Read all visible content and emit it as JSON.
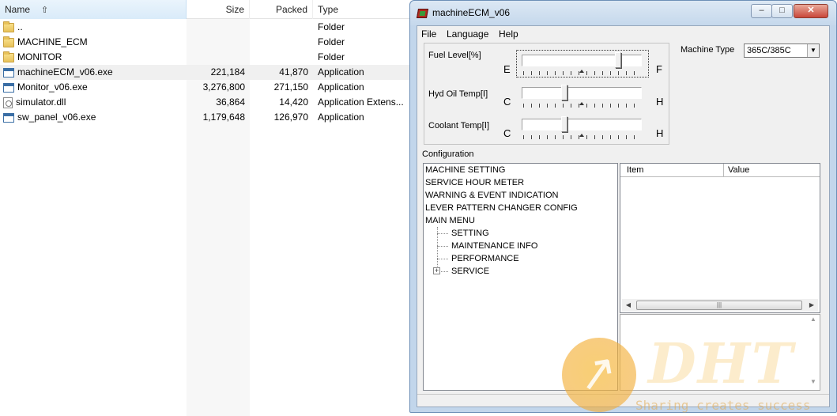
{
  "file_manager": {
    "columns": {
      "name": "Name",
      "size": "Size",
      "packed": "Packed",
      "type": "Type"
    },
    "sort_icon": "sort-up-arrow-icon",
    "rows": [
      {
        "name": "..",
        "size": "",
        "packed": "",
        "type": "Folder",
        "icon": "folder-icon"
      },
      {
        "name": "MACHINE_ECM",
        "size": "",
        "packed": "",
        "type": "Folder",
        "icon": "folder-icon"
      },
      {
        "name": "MONITOR",
        "size": "",
        "packed": "",
        "type": "Folder",
        "icon": "folder-icon"
      },
      {
        "name": "machineECM_v06.exe",
        "size": "221,184",
        "packed": "41,870",
        "type": "Application",
        "icon": "exe-icon"
      },
      {
        "name": "Monitor_v06.exe",
        "size": "3,276,800",
        "packed": "271,150",
        "type": "Application",
        "icon": "exe-icon"
      },
      {
        "name": "simulator.dll",
        "size": "36,864",
        "packed": "14,420",
        "type": "Application Extens...",
        "icon": "dll-icon"
      },
      {
        "name": "sw_panel_v06.exe",
        "size": "1,179,648",
        "packed": "126,970",
        "type": "Application",
        "icon": "exe-icon"
      }
    ]
  },
  "window": {
    "title": "machineECM_v06",
    "controls": {
      "minimize": "–",
      "maximize": "□",
      "close": "✕"
    },
    "menu": {
      "file": "File",
      "language": "Language",
      "help": "Help"
    },
    "gauges": {
      "fuel": {
        "label": "Fuel Level[%]",
        "min": "E",
        "max": "F",
        "level": 0.82
      },
      "hyd_oil": {
        "label": "Hyd Oil Temp[Ⅰ]",
        "min": "C",
        "max": "H",
        "level": 0.35
      },
      "coolant": {
        "label": "Coolant Temp[Ⅰ]",
        "min": "C",
        "max": "H",
        "level": 0.35
      }
    },
    "machine_type": {
      "label": "Machine Type",
      "value": "365C/385C"
    },
    "configuration": {
      "label": "Configuration",
      "items": [
        "MACHINE SETTING",
        "SERVICE HOUR METER",
        "WARNING & EVENT INDICATION",
        "LEVER PATTERN CHANGER CONFIG",
        "MAIN MENU"
      ],
      "children": [
        "SETTING",
        "MAINTENANCE INFO",
        "PERFORMANCE",
        "SERVICE"
      ],
      "expander": "+"
    },
    "grid": {
      "col_item": "Item",
      "col_value": "Value",
      "scroll_grip": "|||"
    }
  },
  "watermark": {
    "logo": "DHT",
    "slogan": "Sharing creates success"
  },
  "colors": {
    "accent": "#3a6ea5",
    "window_frame": "#c2d6eb",
    "watermark": "#f0a028"
  }
}
